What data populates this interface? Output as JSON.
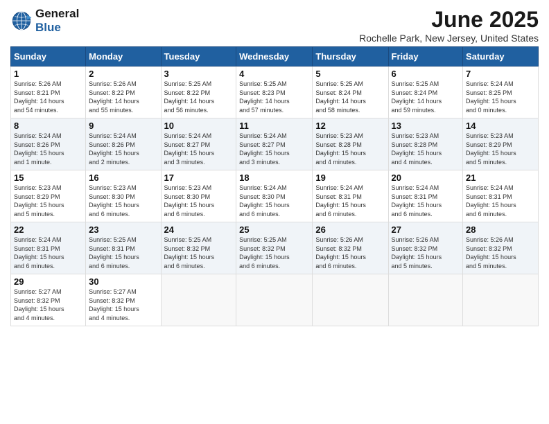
{
  "header": {
    "logo_line1": "General",
    "logo_line2": "Blue",
    "month": "June 2025",
    "location": "Rochelle Park, New Jersey, United States"
  },
  "days_of_week": [
    "Sunday",
    "Monday",
    "Tuesday",
    "Wednesday",
    "Thursday",
    "Friday",
    "Saturday"
  ],
  "weeks": [
    [
      {
        "day": "1",
        "info": "Sunrise: 5:26 AM\nSunset: 8:21 PM\nDaylight: 14 hours\nand 54 minutes."
      },
      {
        "day": "2",
        "info": "Sunrise: 5:26 AM\nSunset: 8:22 PM\nDaylight: 14 hours\nand 55 minutes."
      },
      {
        "day": "3",
        "info": "Sunrise: 5:25 AM\nSunset: 8:22 PM\nDaylight: 14 hours\nand 56 minutes."
      },
      {
        "day": "4",
        "info": "Sunrise: 5:25 AM\nSunset: 8:23 PM\nDaylight: 14 hours\nand 57 minutes."
      },
      {
        "day": "5",
        "info": "Sunrise: 5:25 AM\nSunset: 8:24 PM\nDaylight: 14 hours\nand 58 minutes."
      },
      {
        "day": "6",
        "info": "Sunrise: 5:25 AM\nSunset: 8:24 PM\nDaylight: 14 hours\nand 59 minutes."
      },
      {
        "day": "7",
        "info": "Sunrise: 5:24 AM\nSunset: 8:25 PM\nDaylight: 15 hours\nand 0 minutes."
      }
    ],
    [
      {
        "day": "8",
        "info": "Sunrise: 5:24 AM\nSunset: 8:26 PM\nDaylight: 15 hours\nand 1 minute."
      },
      {
        "day": "9",
        "info": "Sunrise: 5:24 AM\nSunset: 8:26 PM\nDaylight: 15 hours\nand 2 minutes."
      },
      {
        "day": "10",
        "info": "Sunrise: 5:24 AM\nSunset: 8:27 PM\nDaylight: 15 hours\nand 3 minutes."
      },
      {
        "day": "11",
        "info": "Sunrise: 5:24 AM\nSunset: 8:27 PM\nDaylight: 15 hours\nand 3 minutes."
      },
      {
        "day": "12",
        "info": "Sunrise: 5:23 AM\nSunset: 8:28 PM\nDaylight: 15 hours\nand 4 minutes."
      },
      {
        "day": "13",
        "info": "Sunrise: 5:23 AM\nSunset: 8:28 PM\nDaylight: 15 hours\nand 4 minutes."
      },
      {
        "day": "14",
        "info": "Sunrise: 5:23 AM\nSunset: 8:29 PM\nDaylight: 15 hours\nand 5 minutes."
      }
    ],
    [
      {
        "day": "15",
        "info": "Sunrise: 5:23 AM\nSunset: 8:29 PM\nDaylight: 15 hours\nand 5 minutes."
      },
      {
        "day": "16",
        "info": "Sunrise: 5:23 AM\nSunset: 8:30 PM\nDaylight: 15 hours\nand 6 minutes."
      },
      {
        "day": "17",
        "info": "Sunrise: 5:23 AM\nSunset: 8:30 PM\nDaylight: 15 hours\nand 6 minutes."
      },
      {
        "day": "18",
        "info": "Sunrise: 5:24 AM\nSunset: 8:30 PM\nDaylight: 15 hours\nand 6 minutes."
      },
      {
        "day": "19",
        "info": "Sunrise: 5:24 AM\nSunset: 8:31 PM\nDaylight: 15 hours\nand 6 minutes."
      },
      {
        "day": "20",
        "info": "Sunrise: 5:24 AM\nSunset: 8:31 PM\nDaylight: 15 hours\nand 6 minutes."
      },
      {
        "day": "21",
        "info": "Sunrise: 5:24 AM\nSunset: 8:31 PM\nDaylight: 15 hours\nand 6 minutes."
      }
    ],
    [
      {
        "day": "22",
        "info": "Sunrise: 5:24 AM\nSunset: 8:31 PM\nDaylight: 15 hours\nand 6 minutes."
      },
      {
        "day": "23",
        "info": "Sunrise: 5:25 AM\nSunset: 8:31 PM\nDaylight: 15 hours\nand 6 minutes."
      },
      {
        "day": "24",
        "info": "Sunrise: 5:25 AM\nSunset: 8:32 PM\nDaylight: 15 hours\nand 6 minutes."
      },
      {
        "day": "25",
        "info": "Sunrise: 5:25 AM\nSunset: 8:32 PM\nDaylight: 15 hours\nand 6 minutes."
      },
      {
        "day": "26",
        "info": "Sunrise: 5:26 AM\nSunset: 8:32 PM\nDaylight: 15 hours\nand 6 minutes."
      },
      {
        "day": "27",
        "info": "Sunrise: 5:26 AM\nSunset: 8:32 PM\nDaylight: 15 hours\nand 5 minutes."
      },
      {
        "day": "28",
        "info": "Sunrise: 5:26 AM\nSunset: 8:32 PM\nDaylight: 15 hours\nand 5 minutes."
      }
    ],
    [
      {
        "day": "29",
        "info": "Sunrise: 5:27 AM\nSunset: 8:32 PM\nDaylight: 15 hours\nand 4 minutes."
      },
      {
        "day": "30",
        "info": "Sunrise: 5:27 AM\nSunset: 8:32 PM\nDaylight: 15 hours\nand 4 minutes."
      },
      {
        "day": "",
        "info": ""
      },
      {
        "day": "",
        "info": ""
      },
      {
        "day": "",
        "info": ""
      },
      {
        "day": "",
        "info": ""
      },
      {
        "day": "",
        "info": ""
      }
    ]
  ]
}
